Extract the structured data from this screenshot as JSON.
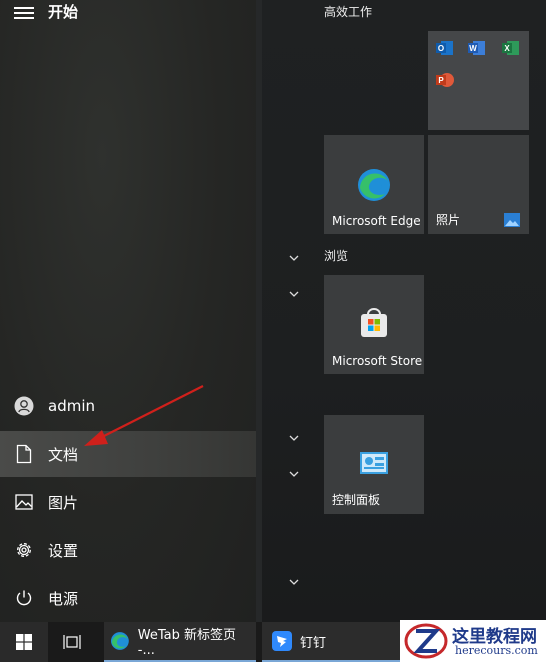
{
  "start_menu": {
    "title": "开始",
    "nav_items": [
      {
        "label": "admin",
        "icon": "user-icon"
      },
      {
        "label": "文档",
        "icon": "document-icon"
      },
      {
        "label": "图片",
        "icon": "pictures-icon"
      },
      {
        "label": "设置",
        "icon": "gear-icon"
      },
      {
        "label": "电源",
        "icon": "power-icon"
      }
    ]
  },
  "groups": {
    "productivity": "高效工作",
    "browse": "浏览"
  },
  "tiles": {
    "edge": "Microsoft Edge",
    "photos": "照片",
    "store": "Microsoft Store",
    "control_panel": "控制面板"
  },
  "taskbar": {
    "wetab": "WeTab 新标签页 -...",
    "dingtalk": "钉钉"
  },
  "watermark": {
    "title": "这里教程网",
    "url": "herecours.com"
  },
  "colors": {
    "accent_arrow": "#d0201b",
    "active_item": "#454644",
    "tile_bg": "#3b3d3e"
  }
}
